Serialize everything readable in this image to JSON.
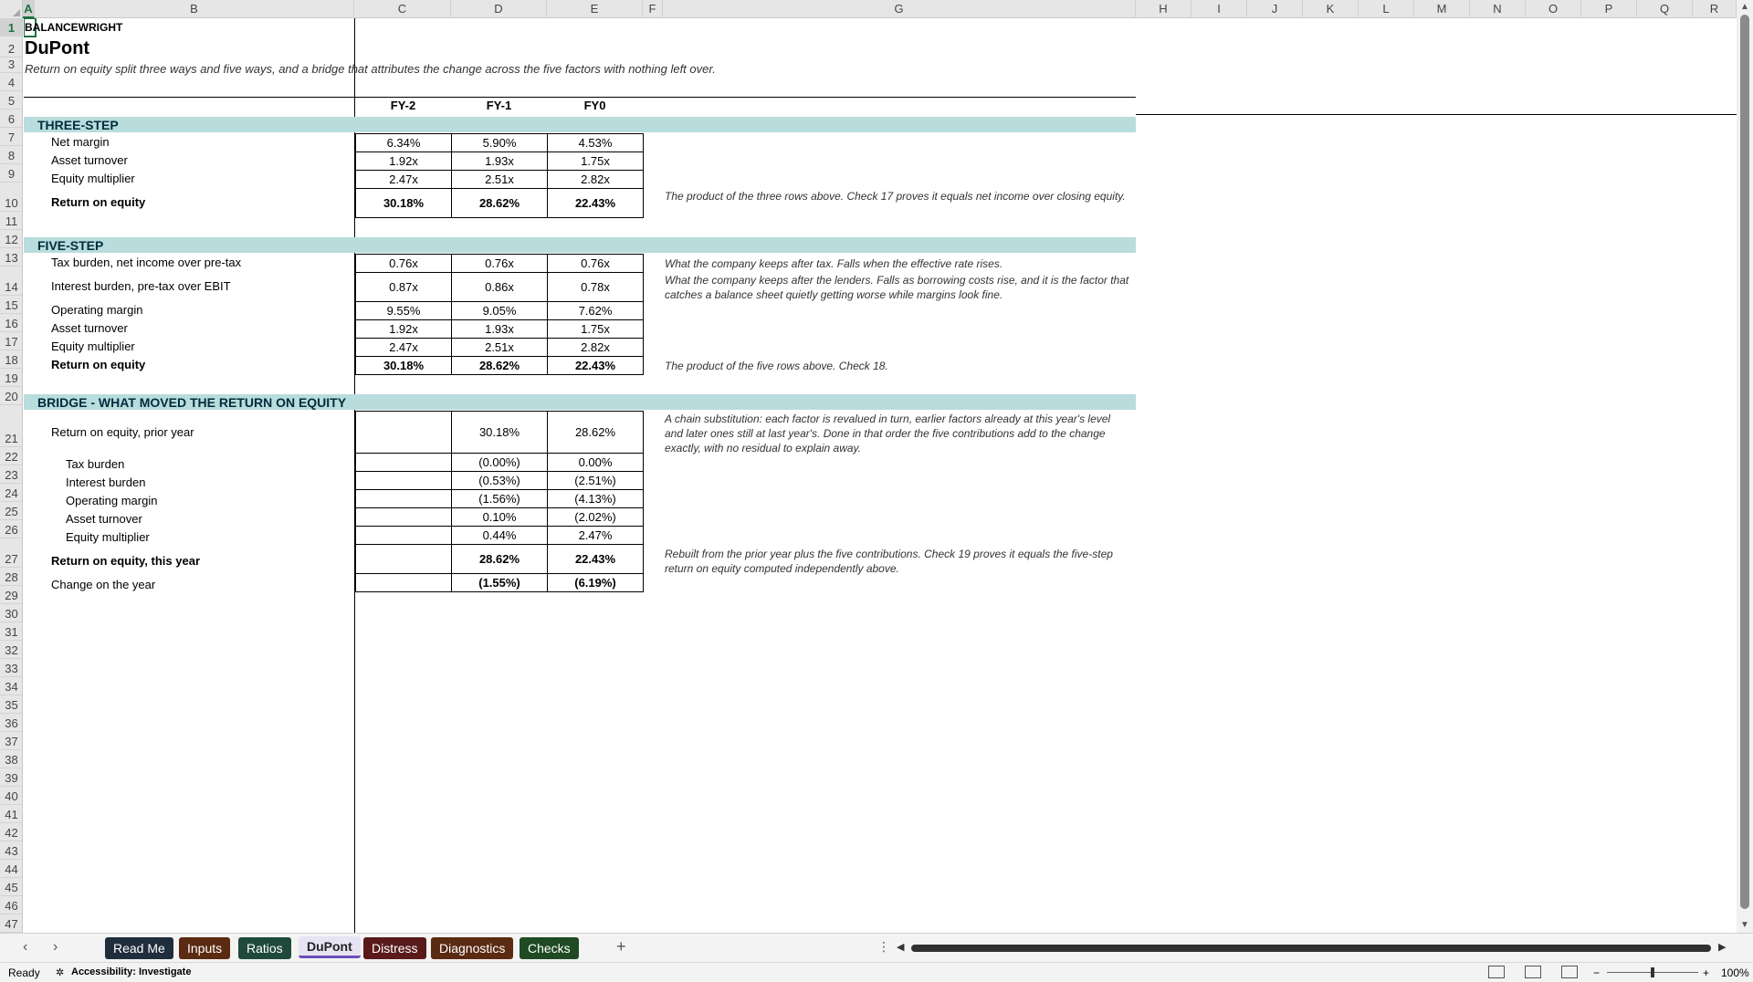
{
  "columns": [
    "A",
    "B",
    "C",
    "D",
    "E",
    "F",
    "G",
    "H",
    "I",
    "J",
    "K",
    "L",
    "M",
    "N",
    "O",
    "P",
    "Q",
    "R"
  ],
  "rows": [
    "1",
    "2",
    "3",
    "4",
    "5",
    "6",
    "7",
    "8",
    "9",
    "10",
    "11",
    "12",
    "13",
    "14",
    "15",
    "16",
    "17",
    "18",
    "19",
    "20",
    "21",
    "22",
    "23",
    "24",
    "25",
    "26",
    "27",
    "28",
    "29",
    "30",
    "31",
    "32",
    "33",
    "34",
    "35",
    "36",
    "37",
    "38",
    "39",
    "40",
    "41",
    "42",
    "43",
    "44",
    "45",
    "46",
    "47"
  ],
  "sheet": {
    "brand": "BALANCEWRIGHT",
    "title": "DuPont",
    "subtitle": "Return on equity split three ways and five ways, and a bridge that attributes the change across the five factors with nothing left over.",
    "periods": [
      "FY-2",
      "FY-1",
      "FY0"
    ],
    "three_step": {
      "label": "THREE-STEP",
      "rows": [
        {
          "label": "Net margin",
          "values": [
            "6.34%",
            "5.90%",
            "4.53%"
          ]
        },
        {
          "label": "Asset turnover",
          "values": [
            "1.92x",
            "1.93x",
            "1.75x"
          ]
        },
        {
          "label": "Equity multiplier",
          "values": [
            "2.47x",
            "2.51x",
            "2.82x"
          ]
        }
      ],
      "total": {
        "label": "Return on equity",
        "values": [
          "30.18%",
          "28.62%",
          "22.43%"
        ],
        "note": "The product of the three rows above. Check 17 proves it equals net income over closing equity."
      }
    },
    "five_step": {
      "label": "FIVE-STEP",
      "rows": [
        {
          "label": "Tax burden, net income over pre-tax",
          "values": [
            "0.76x",
            "0.76x",
            "0.76x"
          ],
          "note": "What the company keeps after tax. Falls when the effective rate rises."
        },
        {
          "label": "Interest burden, pre-tax over EBIT",
          "values": [
            "0.87x",
            "0.86x",
            "0.78x"
          ],
          "note": "What the company keeps after the lenders. Falls as borrowing costs rise, and it is the factor that catches a balance sheet quietly getting worse while margins look fine."
        },
        {
          "label": "Operating margin",
          "values": [
            "9.55%",
            "9.05%",
            "7.62%"
          ],
          "note": ""
        },
        {
          "label": "Asset turnover",
          "values": [
            "1.92x",
            "1.93x",
            "1.75x"
          ],
          "note": ""
        },
        {
          "label": "Equity multiplier",
          "values": [
            "2.47x",
            "2.51x",
            "2.82x"
          ],
          "note": ""
        }
      ],
      "total": {
        "label": "Return on equity",
        "values": [
          "30.18%",
          "28.62%",
          "22.43%"
        ],
        "note": "The product of the five rows above. Check 18."
      }
    },
    "bridge": {
      "label": "BRIDGE - WHAT MOVED THE RETURN ON EQUITY",
      "prior": {
        "label": "Return on equity, prior year",
        "values": [
          "",
          "30.18%",
          "28.62%"
        ],
        "note": "A chain substitution: each factor is revalued in turn, earlier factors already at this year's level and later ones still at last year's. Done in that order the five contributions add to the change exactly, with no residual to explain away."
      },
      "factors": [
        {
          "label": "Tax burden",
          "values": [
            "",
            "(0.00%)",
            "0.00%"
          ]
        },
        {
          "label": "Interest burden",
          "values": [
            "",
            "(0.53%)",
            "(2.51%)"
          ]
        },
        {
          "label": "Operating margin",
          "values": [
            "",
            "(1.56%)",
            "(4.13%)"
          ]
        },
        {
          "label": "Asset turnover",
          "values": [
            "",
            "0.10%",
            "(2.02%)"
          ]
        },
        {
          "label": "Equity multiplier",
          "values": [
            "",
            "0.44%",
            "2.47%"
          ]
        }
      ],
      "this_year": {
        "label": "Return on equity, this year",
        "values": [
          "",
          "28.62%",
          "22.43%"
        ],
        "note": "Rebuilt from the prior year plus the five contributions. Check 19 proves it equals the five-step return on equity computed independently above."
      },
      "change": {
        "label": "Change on the year",
        "values": [
          "",
          "(1.55%)",
          "(6.19%)"
        ]
      }
    }
  },
  "tabs": [
    {
      "label": "Read Me",
      "color": "#1f2d3d"
    },
    {
      "label": "Inputs",
      "color": "#5a2a12"
    },
    {
      "label": "Ratios",
      "color": "#1f4a3a"
    },
    {
      "label": "DuPont",
      "color": "#e7e3f3"
    },
    {
      "label": "Distress",
      "color": "#5a1a1a"
    },
    {
      "label": "Diagnostics",
      "color": "#5a2a12"
    },
    {
      "label": "Checks",
      "color": "#1e4a24"
    }
  ],
  "active_tab": "DuPont",
  "status": {
    "ready": "Ready",
    "accessibility": "Accessibility: Investigate",
    "zoom": "100%"
  }
}
